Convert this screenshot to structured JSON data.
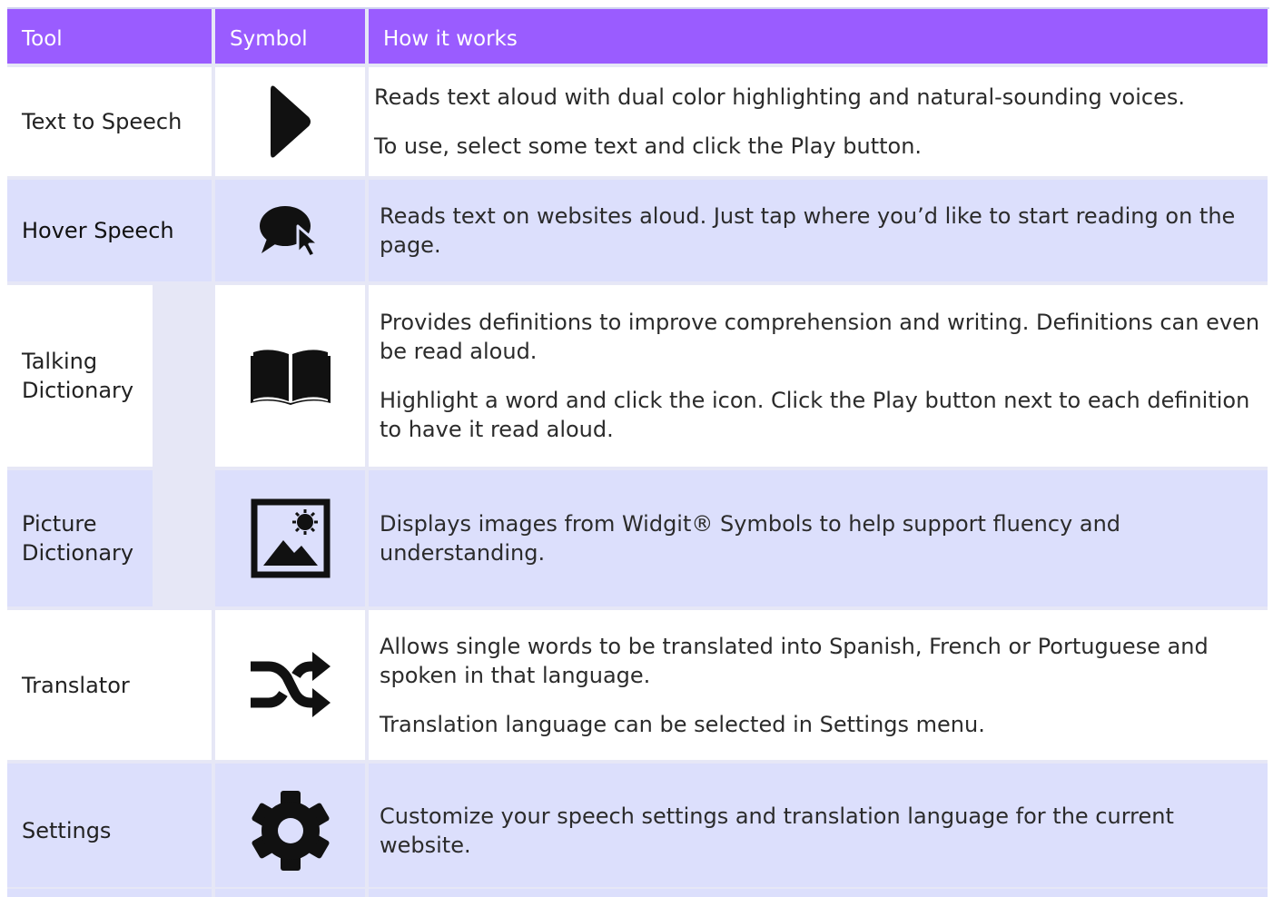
{
  "header": {
    "tool": "Tool",
    "symbol": "Symbol",
    "how": "How it works"
  },
  "rows": [
    {
      "tool": "Text to Speech",
      "icon": "play-icon",
      "desc": [
        "Reads text aloud with dual color highlighting and natural-sounding voices.",
        "To use, select some text and click the Play button."
      ]
    },
    {
      "tool": "Hover Speech",
      "icon": "speech-bubble-cursor-icon",
      "desc": [
        "Reads text on websites aloud. Just tap where you’d like to start reading on the page."
      ]
    },
    {
      "tool": "Talking Dictionary",
      "icon": "open-book-icon",
      "desc": [
        "Provides definitions to improve comprehension and writing. Definitions can even be read aloud.",
        "Highlight a word and click the icon. Click the Play button next to each definition to have it read aloud."
      ]
    },
    {
      "tool": "Picture Dictionary",
      "icon": "picture-icon",
      "desc": [
        "Displays images from Widgit® Symbols to help support fluency and understanding."
      ]
    },
    {
      "tool": "Translator",
      "icon": "shuffle-icon",
      "desc": [
        "Allows single words to be translated into Spanish, French or Portuguese and spoken in that language.",
        "Translation language can be selected in Settings menu."
      ]
    },
    {
      "tool": "Settings",
      "icon": "gear-icon",
      "desc": [
        "Customize your speech settings and translation language for the current website."
      ]
    }
  ],
  "colors": {
    "header_bg": "#9a5cff",
    "row_lavender": "#dcdffc",
    "row_white": "#ffffff"
  }
}
